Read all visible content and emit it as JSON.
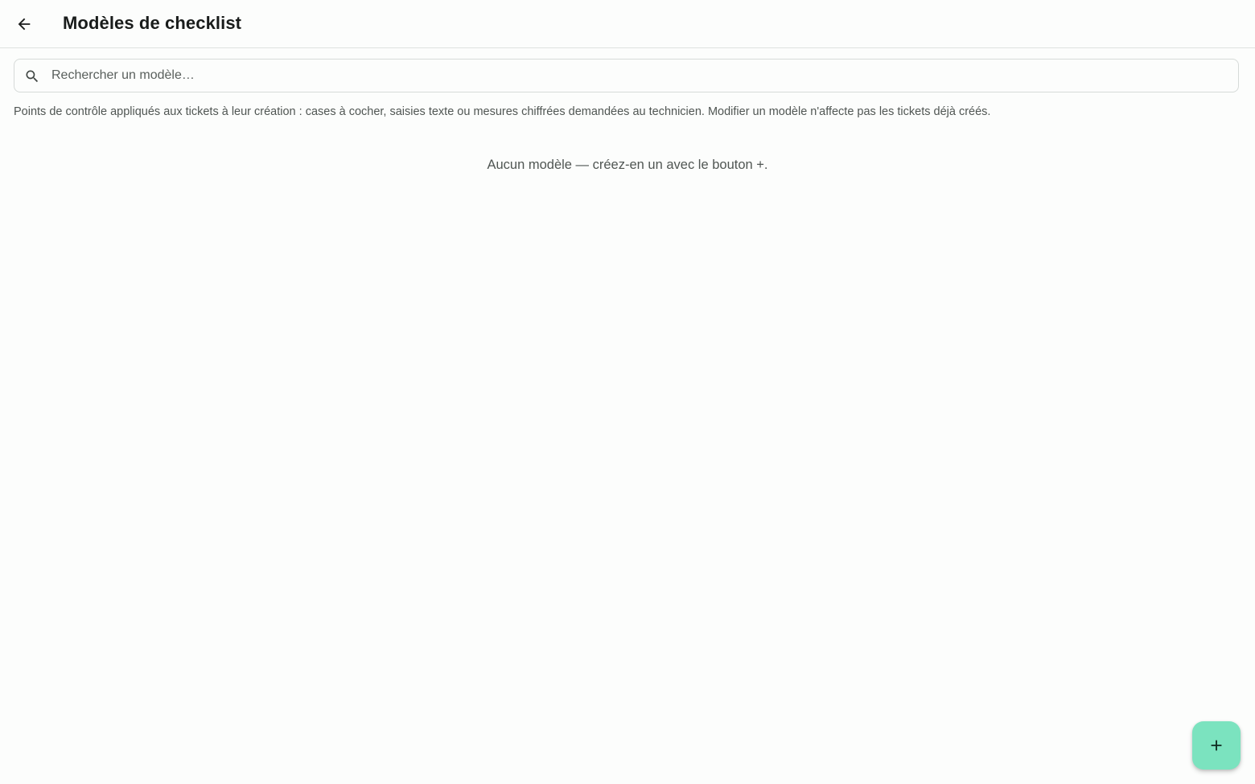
{
  "header": {
    "back_icon": "arrow-left-icon",
    "title": "Modèles de checklist"
  },
  "search": {
    "icon": "search-icon",
    "placeholder": "Rechercher un modèle…",
    "value": ""
  },
  "help_text": "Points de contrôle appliqués aux tickets à leur création : cases à cocher, saisies texte ou mesures chiffrées demandées au technicien. Modifier un modèle n'affecte pas les tickets déjà créés.",
  "empty_state": "Aucun modèle — créez-en un avec le bouton +.",
  "fab": {
    "icon": "plus-icon"
  },
  "colors": {
    "background": "#fcfdfc",
    "fab": "#7be3bf",
    "text_primary": "#191c1b",
    "text_secondary": "#505653",
    "border": "#d6dad8"
  }
}
